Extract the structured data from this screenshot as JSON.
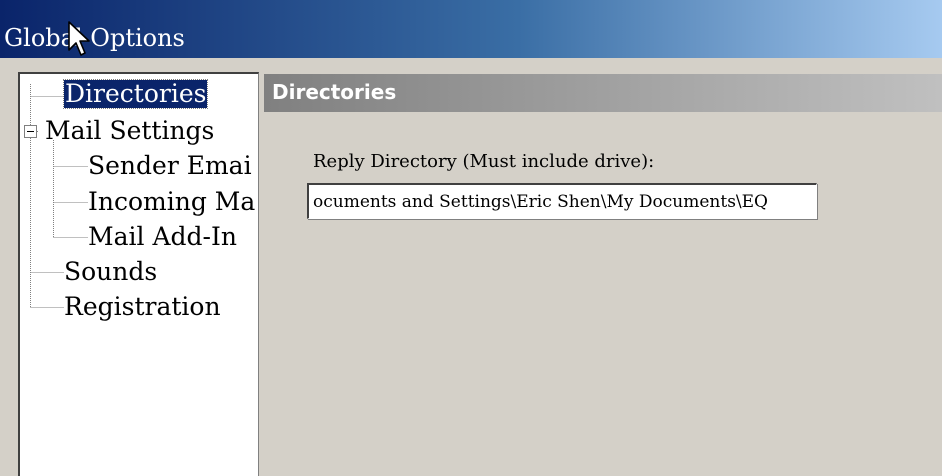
{
  "window": {
    "title": "Global Options"
  },
  "tree": {
    "items": [
      {
        "label": "Directories",
        "selected": true
      },
      {
        "label": "Mail Settings",
        "expander": "⊟"
      },
      {
        "label": "Sender Emai"
      },
      {
        "label": "Incoming Ma"
      },
      {
        "label": "Mail Add-In"
      },
      {
        "label": "Sounds"
      },
      {
        "label": "Registration"
      }
    ]
  },
  "panel": {
    "header": "Directories",
    "reply_directory": {
      "label": "Reply Directory (Must include drive):",
      "value": "ocuments and Settings\\Eric Shen\\My Documents\\EQ"
    }
  },
  "colors": {
    "title_gradient_start": "#0a246a",
    "title_gradient_end": "#a6caf0",
    "selection": "#0a246a",
    "dialog_face": "#d4d0c8",
    "header_bar": "#808080"
  }
}
